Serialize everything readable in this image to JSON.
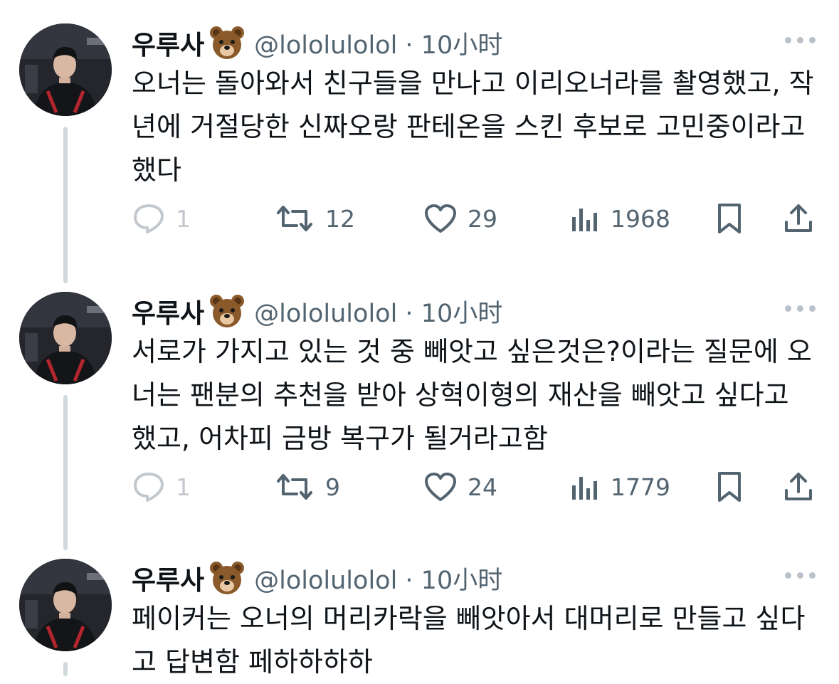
{
  "author": {
    "name": "우루사",
    "emoji_icon": "bear-face-icon",
    "handle_line": "@lololulolol · 10小时"
  },
  "tweets": [
    {
      "text": "오너는 돌아와서 친구들을 만나고 이리오너라를 촬영했고, 작년에 거절당한 신짜오랑 판테온을 스킨 후보로 고민중이라고 했다",
      "replies": "1",
      "retweets": "12",
      "likes": "29",
      "views": "1968"
    },
    {
      "text": "서로가 가지고 있는 것 중 빼앗고 싶은것은?이라는 질문에 오너는 팬분의 추천을 받아 상혁이형의 재산을 빼앗고 싶다고 했고, 어차피 금방 복구가 될거라고함",
      "replies": "1",
      "retweets": "9",
      "likes": "24",
      "views": "1779"
    },
    {
      "text": "페이커는 오너의 머리카락을 빼앗아서 대머리로 만들고 싶다고 답변함 페하하하하"
    }
  ],
  "colors": {
    "text": "#0f1419",
    "muted": "#536471",
    "thread_line": "#cfd9de",
    "background": "#ffffff"
  }
}
